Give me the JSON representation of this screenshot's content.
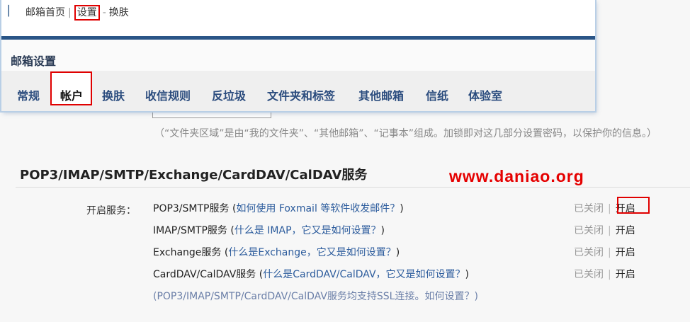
{
  "topnav": {
    "home": "邮箱首页",
    "sep1": "|",
    "settings": "设置",
    "sep2": "-",
    "skin": "换肤"
  },
  "settings_title": "邮箱设置",
  "tabs": [
    {
      "label": "常规"
    },
    {
      "label": "帐户",
      "active": true
    },
    {
      "label": "换肤"
    },
    {
      "label": "收信规则"
    },
    {
      "label": "反垃圾"
    },
    {
      "label": "文件夹和标签"
    },
    {
      "label": "其他邮箱"
    },
    {
      "label": "信纸"
    },
    {
      "label": "体验室"
    }
  ],
  "folder_lock": {
    "hint": "（“文件夹区域”是由“我的文件夹”、“其他邮箱”、“记事本”组成。加锁即对这几部分设置密码，以保护你的信息。）"
  },
  "section": {
    "title": "POP3/IMAP/SMTP/Exchange/CardDAV/CalDAV服务"
  },
  "watermark": "www.daniao.org",
  "services_label": "开启服务：",
  "services": [
    {
      "name": "POP3/SMTP服务",
      "open_paren": " (",
      "help": "如何使用 Foxmail 等软件收发邮件？",
      "close_paren": ")",
      "status_closed": "已关闭",
      "sep": "|",
      "action": "开启"
    },
    {
      "name": "IMAP/SMTP服务",
      "open_paren": " (",
      "help": "什么是 IMAP，它又是如何设置？",
      "close_paren": ")",
      "status_closed": "已关闭",
      "sep": "|",
      "action": "开启"
    },
    {
      "name": "Exchange服务",
      "open_paren": " (",
      "help": "什么是Exchange，它又是如何设置？",
      "close_paren": ")",
      "status_closed": "已关闭",
      "sep": "|",
      "action": "开启"
    },
    {
      "name": "CardDAV/CalDAV服务",
      "open_paren": " (",
      "help": "什么是CardDAV/CalDAV，它又是如何设置？",
      "close_paren": ")",
      "status_closed": "已关闭",
      "sep": "|",
      "action": "开启"
    }
  ],
  "ssl_note": {
    "text": "(POP3/IMAP/SMTP/CardDAV/CalDAV服务均支持SSL连接。",
    "link": "如何设置？",
    "close": ")"
  },
  "colors": {
    "brand_blue": "#2a5587",
    "tab_blue": "#2b4c7e",
    "highlight_red": "#e00000",
    "watermark_red": "#e50000",
    "help_link": "#2b5b9c"
  }
}
